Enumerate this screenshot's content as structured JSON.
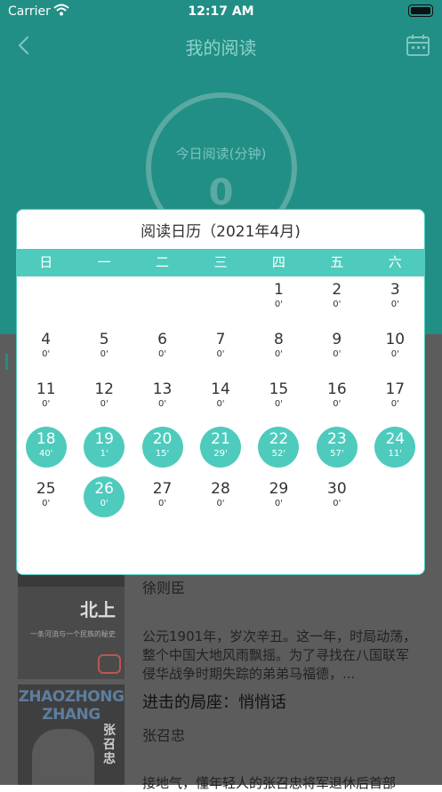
{
  "status": {
    "carrier": "Carrier",
    "time": "12:17 AM"
  },
  "header": {
    "title": "我的阅读"
  },
  "today": {
    "label": "今日阅读(分钟)",
    "value": "0"
  },
  "calendar": {
    "title": "阅读日历（2021年4月)",
    "weekdays": [
      "日",
      "一",
      "二",
      "三",
      "四",
      "五",
      "六"
    ],
    "weeks": [
      [
        null,
        null,
        null,
        null,
        {
          "day": "1",
          "mins": "0'"
        },
        {
          "day": "2",
          "mins": "0'"
        },
        {
          "day": "3",
          "mins": "0'"
        }
      ],
      [
        {
          "day": "4",
          "mins": "0'"
        },
        {
          "day": "5",
          "mins": "0'"
        },
        {
          "day": "6",
          "mins": "0'"
        },
        {
          "day": "7",
          "mins": "0'"
        },
        {
          "day": "8",
          "mins": "0'"
        },
        {
          "day": "9",
          "mins": "0'"
        },
        {
          "day": "10",
          "mins": "0'"
        }
      ],
      [
        {
          "day": "11",
          "mins": "0'"
        },
        {
          "day": "12",
          "mins": "0'"
        },
        {
          "day": "13",
          "mins": "0'"
        },
        {
          "day": "14",
          "mins": "0'"
        },
        {
          "day": "15",
          "mins": "0'"
        },
        {
          "day": "16",
          "mins": "0'"
        },
        {
          "day": "17",
          "mins": "0'"
        }
      ],
      [
        {
          "day": "18",
          "mins": "40'",
          "active": true
        },
        {
          "day": "19",
          "mins": "1'",
          "active": true
        },
        {
          "day": "20",
          "mins": "15'",
          "active": true
        },
        {
          "day": "21",
          "mins": "29'",
          "active": true
        },
        {
          "day": "22",
          "mins": "52'",
          "active": true
        },
        {
          "day": "23",
          "mins": "57'",
          "active": true
        },
        {
          "day": "24",
          "mins": "11'",
          "active": true
        }
      ],
      [
        {
          "day": "25",
          "mins": "0'"
        },
        {
          "day": "26",
          "mins": "0'",
          "active": true
        },
        {
          "day": "27",
          "mins": "0'"
        },
        {
          "day": "28",
          "mins": "0'"
        },
        {
          "day": "29",
          "mins": "0'"
        },
        {
          "day": "30",
          "mins": "0'"
        },
        null
      ]
    ]
  },
  "books": [
    {
      "cover_title": "北上",
      "cover_subtitle": "一条河流与一个民族的秘史",
      "author": "徐则臣",
      "description": "公元1901年，岁次辛丑。这一年，时局动荡，整个中国大地风雨飘摇。为了寻找在八国联军侵华战争时期失踪的弟弟马福德，..."
    },
    {
      "cover_en": "ZHAOZHONG ZHANG",
      "cover_name": "张召忠",
      "title": "进击的局座：悄悄话",
      "author": "张召忠",
      "description": "接地气，懂年轻人的张召忠将军退休后首部"
    }
  ],
  "colors": {
    "primary": "#218f86",
    "accent": "#4ecbbd",
    "overlay": "#5c5c5c"
  },
  "icons": {
    "back": "chevron-left-icon",
    "calendar": "calendar-icon"
  }
}
